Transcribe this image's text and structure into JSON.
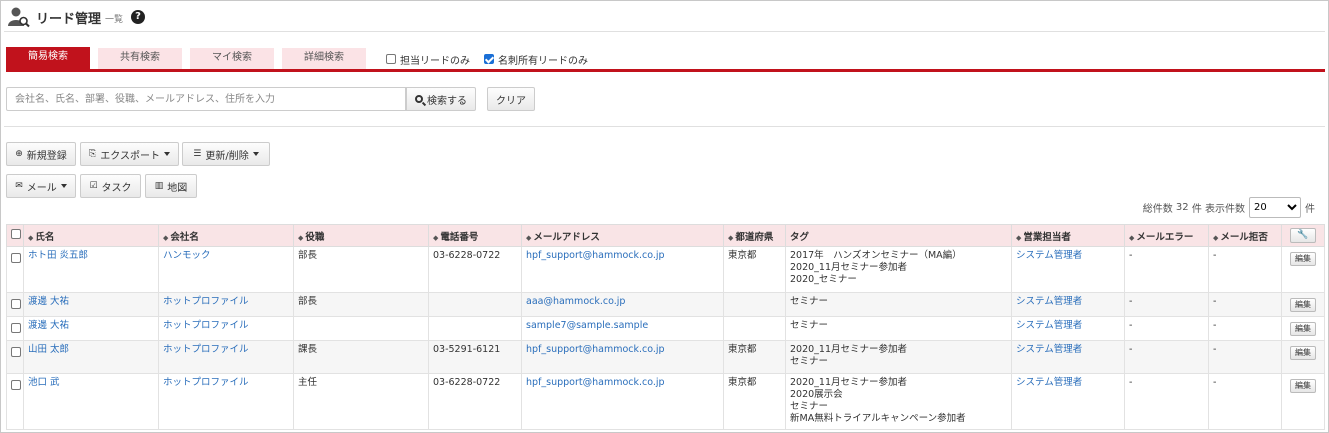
{
  "header": {
    "title": "リード管理",
    "subtitle": "一覧",
    "help": "?"
  },
  "tabs": [
    {
      "label": "簡易検索",
      "active": true
    },
    {
      "label": "共有検索",
      "active": false
    },
    {
      "label": "マイ検索",
      "active": false
    },
    {
      "label": "詳細検索",
      "active": false
    }
  ],
  "filters": {
    "assigned_only": {
      "label": "担当リードのみ",
      "checked": false
    },
    "card_owned_only": {
      "label": "名刺所有リードのみ",
      "checked": true
    }
  },
  "search": {
    "placeholder": "会社名、氏名、部署、役職、メールアドレス、住所を入力",
    "search_button": "検索する",
    "clear_button": "クリア"
  },
  "toolbar": {
    "new": "新規登録",
    "export": "エクスポート",
    "update_delete": "更新/削除",
    "mail": "メール",
    "task": "タスク",
    "map": "地図"
  },
  "count": {
    "total_label": "総件数",
    "total": "32",
    "unit": "件",
    "display_label": "表示件数",
    "page_size": "20",
    "unit2": "件"
  },
  "table": {
    "columns": [
      "氏名",
      "会社名",
      "役職",
      "電話番号",
      "メールアドレス",
      "都道府県",
      "タグ",
      "営業担当者",
      "メールエラー",
      "メール拒否"
    ],
    "edit_label": "編集",
    "rows": [
      {
        "name": "ホト田 炎五郎",
        "company": "ハンモック",
        "title": "部長",
        "phone": "03-6228-0722",
        "email": "hpf_support@hammock.co.jp",
        "pref": "東京都",
        "tags": [
          "2017年　ハンズオンセミナー（MA編）",
          "2020_11月セミナー参加者",
          "2020_セミナー"
        ],
        "owner": "システム管理者",
        "mail_error": "-",
        "mail_reject": "-"
      },
      {
        "name": "渡邊 大祐",
        "company": "ホットプロファイル",
        "title": "部長",
        "phone": "",
        "email": "aaa@hammock.co.jp",
        "pref": "",
        "tags": [
          "セミナー"
        ],
        "owner": "システム管理者",
        "mail_error": "-",
        "mail_reject": "-"
      },
      {
        "name": "渡邊 大祐",
        "company": "ホットプロファイル",
        "title": "",
        "phone": "",
        "email": "sample7@sample.sample",
        "pref": "",
        "tags": [
          "セミナー"
        ],
        "owner": "システム管理者",
        "mail_error": "-",
        "mail_reject": "-"
      },
      {
        "name": "山田 太郎",
        "company": "ホットプロファイル",
        "title": "課長",
        "phone": "03-5291-6121",
        "email": "hpf_support@hammock.co.jp",
        "pref": "東京都",
        "tags": [
          "2020_11月セミナー参加者",
          "セミナー"
        ],
        "owner": "システム管理者",
        "mail_error": "-",
        "mail_reject": "-"
      },
      {
        "name": "池口 武",
        "company": "ホットプロファイル",
        "title": "主任",
        "phone": "03-6228-0722",
        "email": "hpf_support@hammock.co.jp",
        "pref": "東京都",
        "tags": [
          "2020_11月セミナー参加者",
          "2020展示会",
          "セミナー",
          "新MA無料トライアルキャンペーン参加者"
        ],
        "owner": "システム管理者",
        "mail_error": "-",
        "mail_reject": "-"
      }
    ]
  }
}
